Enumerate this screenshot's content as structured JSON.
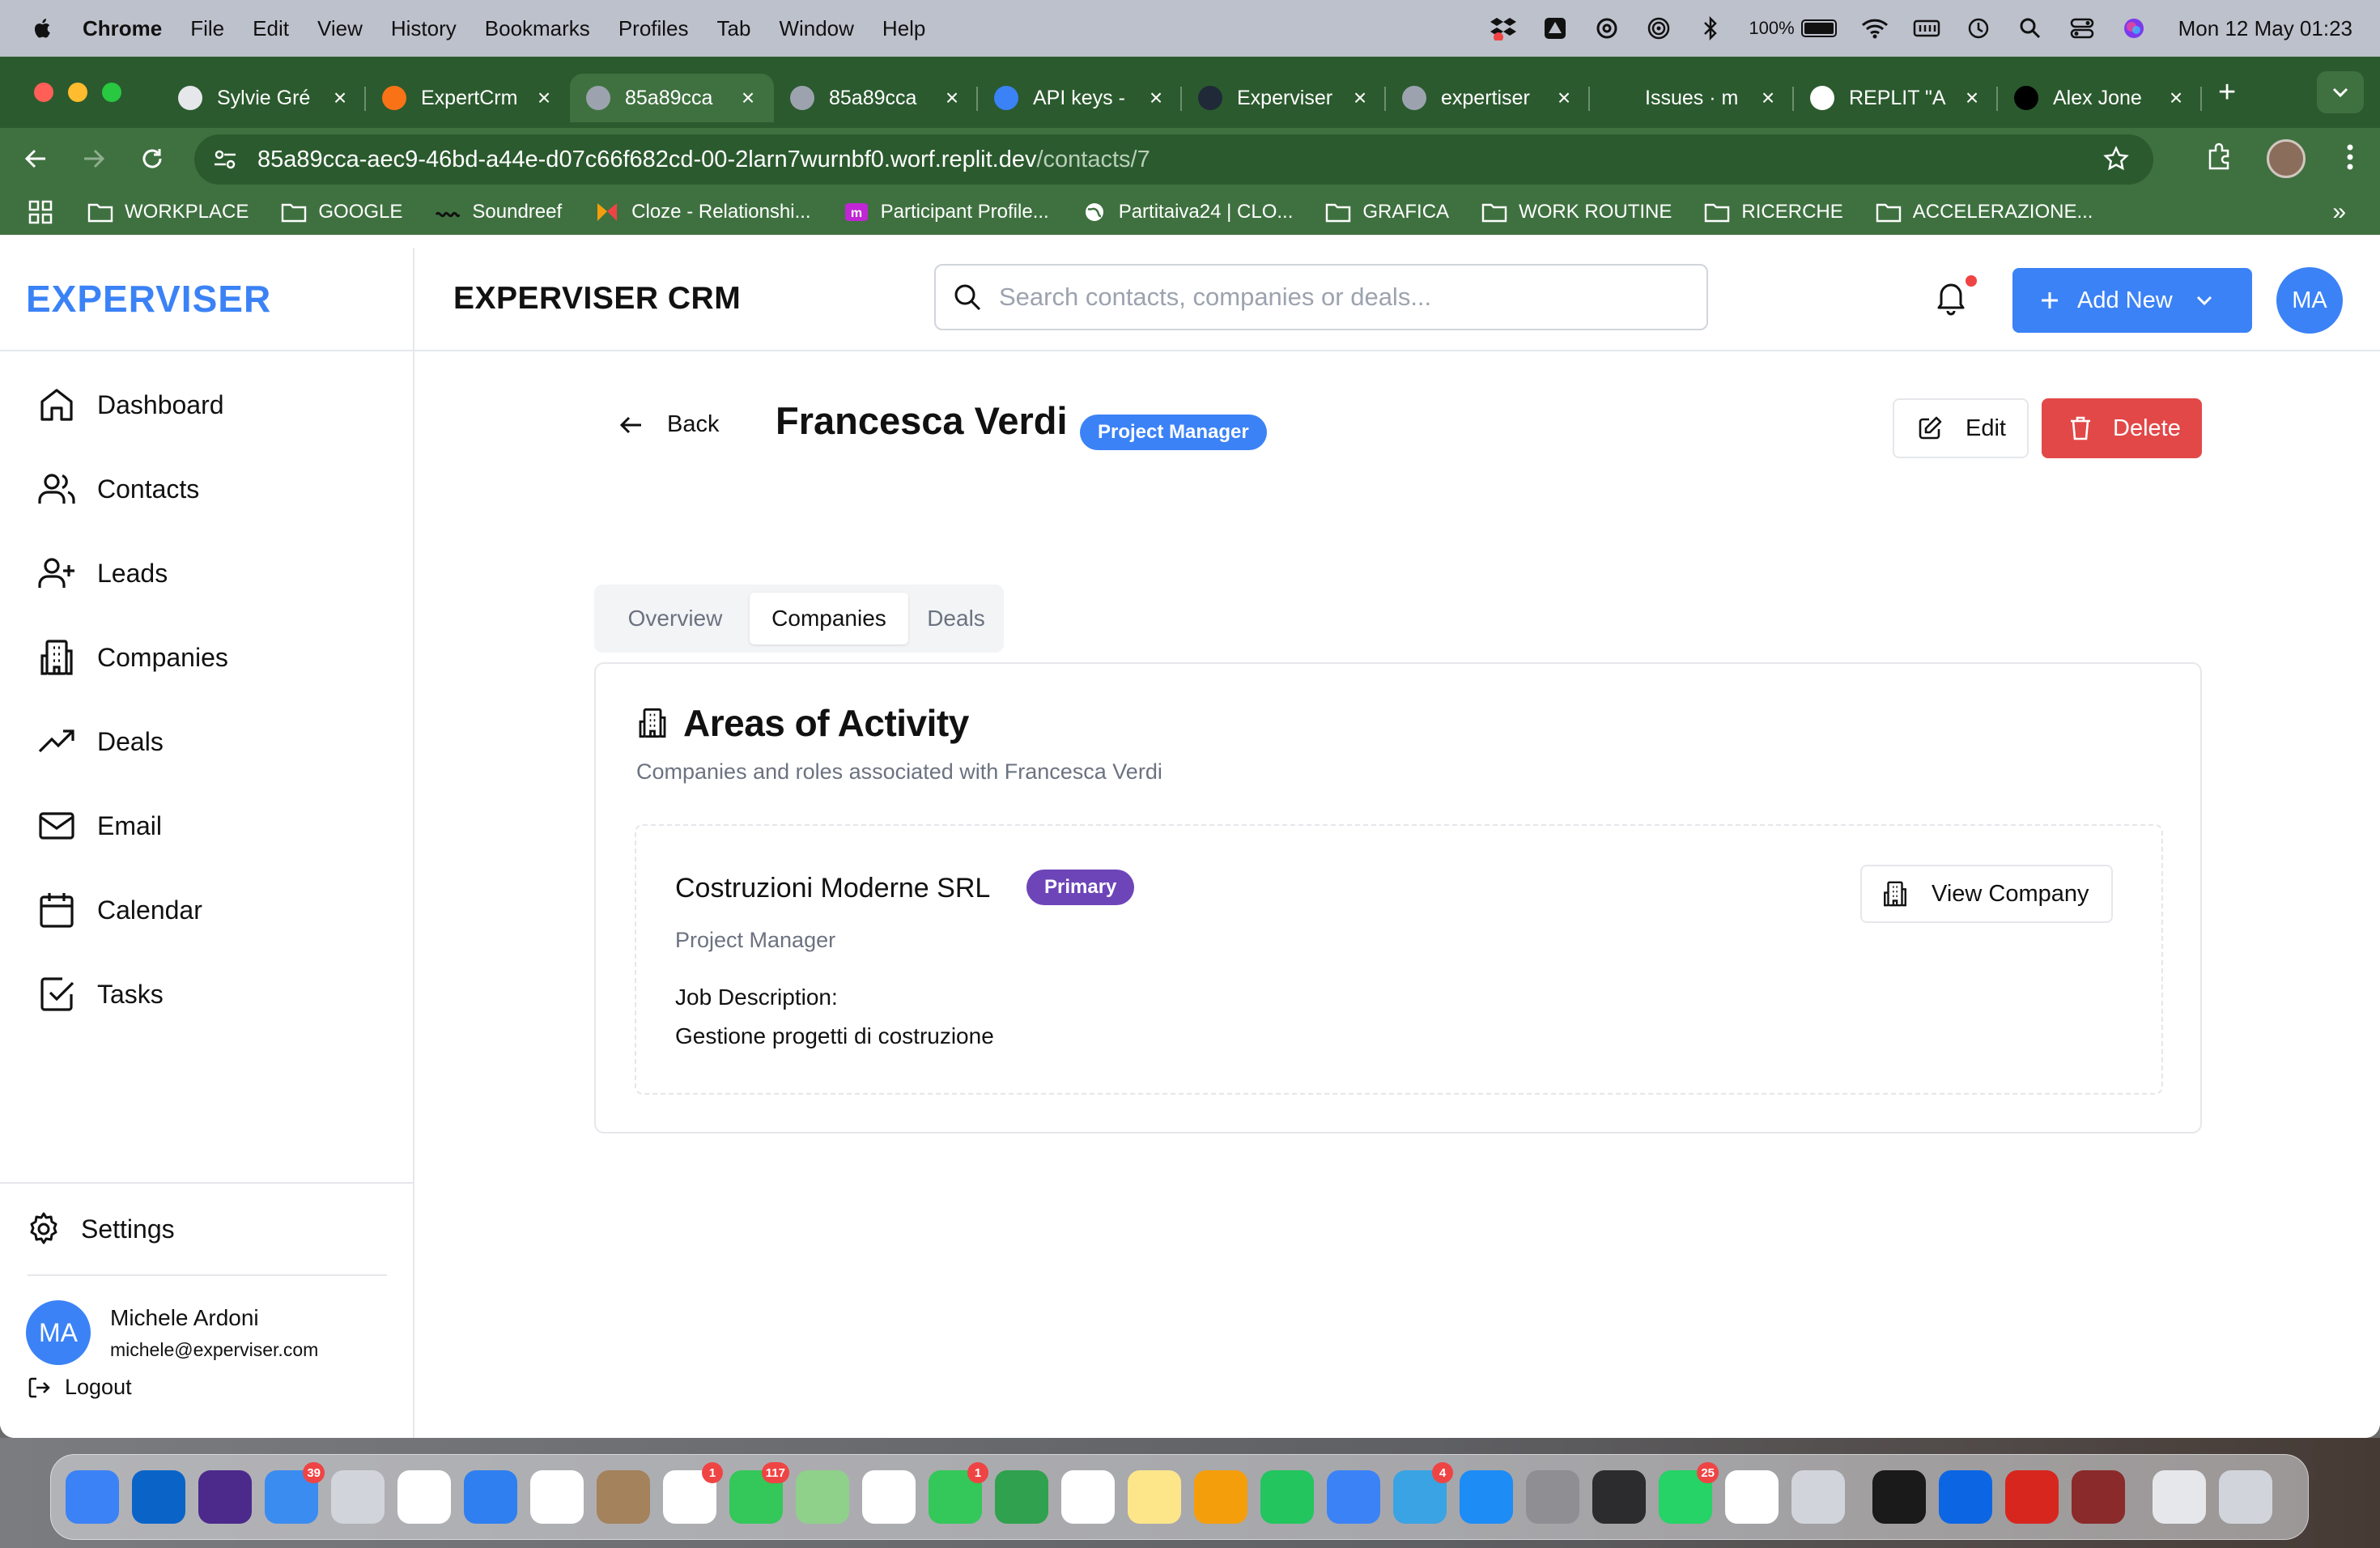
{
  "menubar": {
    "app": "Chrome",
    "menus": [
      "File",
      "Edit",
      "View",
      "History",
      "Bookmarks",
      "Profiles",
      "Tab",
      "Window",
      "Help"
    ],
    "battery": "100%",
    "clock": "Mon 12 May  01:23"
  },
  "browser": {
    "tabs": [
      {
        "title": "Sylvie Gré",
        "favicon_color": "#e5e7eb"
      },
      {
        "title": "ExpertCrm",
        "favicon_color": "#f97316"
      },
      {
        "title": "85a89cca",
        "favicon_color": "#9ca3af"
      },
      {
        "title": "85a89cca",
        "favicon_color": "#9ca3af"
      },
      {
        "title": "API keys -",
        "favicon_color": "#3b82f6"
      },
      {
        "title": "Experviser",
        "favicon_color": "#1f2937"
      },
      {
        "title": "expertiser",
        "favicon_color": "#9ca3af"
      },
      {
        "title": "Issues · m",
        "favicon_color": "#2b5a2e"
      },
      {
        "title": "REPLIT \"A",
        "favicon_color": "#ffffff"
      },
      {
        "title": "Alex Jone",
        "favicon_color": "#000000"
      }
    ],
    "active_tab": 2,
    "url_host": "85a89cca-aec9-46bd-a44e-d07c66f682cd-00-2larn7wurnbf0.worf.replit.dev",
    "url_path": "/contacts/7",
    "bookmarks": [
      {
        "label": "WORKPLACE",
        "icon": "folder-icon"
      },
      {
        "label": "GOOGLE",
        "icon": "folder-icon"
      },
      {
        "label": "Soundreef",
        "icon": "soundreef-icon"
      },
      {
        "label": "Cloze - Relationshi...",
        "icon": "cloze-icon"
      },
      {
        "label": "Participant Profile...",
        "icon": "m-icon"
      },
      {
        "label": "Partitaiva24 | CLO...",
        "icon": "globe-icon"
      },
      {
        "label": "GRAFICA",
        "icon": "folder-icon"
      },
      {
        "label": "WORK ROUTINE",
        "icon": "folder-icon"
      },
      {
        "label": "RICERCHE",
        "icon": "folder-icon"
      },
      {
        "label": "ACCELERAZIONE...",
        "icon": "folder-icon"
      }
    ],
    "more": "»"
  },
  "app": {
    "brand": "EXPERVISER",
    "title": "EXPERVISER CRM",
    "search_placeholder": "Search contacts, companies or deals...",
    "add_new": "Add New",
    "avatar_initials": "MA",
    "accent": "#3b82f6",
    "nav": [
      {
        "label": "Dashboard",
        "icon": "home-icon"
      },
      {
        "label": "Contacts",
        "icon": "users-icon"
      },
      {
        "label": "Leads",
        "icon": "user-plus-icon"
      },
      {
        "label": "Companies",
        "icon": "building-icon"
      },
      {
        "label": "Deals",
        "icon": "trending-up-icon"
      },
      {
        "label": "Email",
        "icon": "mail-icon"
      },
      {
        "label": "Calendar",
        "icon": "calendar-icon"
      },
      {
        "label": "Tasks",
        "icon": "checkbox-icon"
      }
    ],
    "settings": "Settings",
    "user": {
      "initials": "MA",
      "name": "Michele Ardoni",
      "email": "michele@experviser.com"
    },
    "logout": "Logout"
  },
  "contact": {
    "back": "Back",
    "name": "Francesca Verdi",
    "role_badge": "Project Manager",
    "edit": "Edit",
    "delete": "Delete",
    "delete_color": "#e24848",
    "tabs": [
      "Overview",
      "Companies",
      "Deals"
    ],
    "active_tab": "Companies",
    "areas": {
      "title": "Areas of Activity",
      "subtitle": "Companies and roles associated with Francesca Verdi",
      "company": {
        "name": "Costruzioni Moderne SRL",
        "badge": "Primary",
        "badge_color": "#6d45b8",
        "role": "Project Manager",
        "job_label": "Job Description:",
        "job_text": "Gestione progetti di costruzione",
        "view_button": "View Company"
      }
    }
  },
  "dock": {
    "apps": [
      {
        "name": "finder",
        "color": "#3b82f6",
        "badge": ""
      },
      {
        "name": "outlook",
        "color": "#0a64c8",
        "badge": ""
      },
      {
        "name": "siri",
        "color": "#4b2a8c",
        "badge": ""
      },
      {
        "name": "mail",
        "color": "#3b8cf0",
        "badge": "39"
      },
      {
        "name": "launchpad",
        "color": "#d1d5db",
        "badge": ""
      },
      {
        "name": "chrome",
        "color": "#ffffff",
        "badge": ""
      },
      {
        "name": "safari",
        "color": "#2f7ff0",
        "badge": ""
      },
      {
        "name": "opera",
        "color": "#ffffff",
        "badge": ""
      },
      {
        "name": "contacts",
        "color": "#a4825c",
        "badge": ""
      },
      {
        "name": "calendar",
        "color": "#ffffff",
        "badge": "1"
      },
      {
        "name": "messages",
        "color": "#34c759",
        "badge": "117"
      },
      {
        "name": "maps",
        "color": "#8fd18a",
        "badge": ""
      },
      {
        "name": "photos",
        "color": "#ffffff",
        "badge": ""
      },
      {
        "name": "facetime",
        "color": "#34c759",
        "badge": "1"
      },
      {
        "name": "messages-2",
        "color": "#30a14e",
        "badge": ""
      },
      {
        "name": "evernote",
        "color": "#ffffff",
        "badge": ""
      },
      {
        "name": "notes",
        "color": "#fde68a",
        "badge": ""
      },
      {
        "name": "pages",
        "color": "#f59e0b",
        "badge": ""
      },
      {
        "name": "numbers",
        "color": "#22c55e",
        "badge": ""
      },
      {
        "name": "keynote",
        "color": "#3b82f6",
        "badge": ""
      },
      {
        "name": "telegram",
        "color": "#3aa3e3",
        "badge": "4"
      },
      {
        "name": "app-store",
        "color": "#1d8cf5",
        "badge": ""
      },
      {
        "name": "settings",
        "color": "#8e8e93",
        "badge": ""
      },
      {
        "name": "phone",
        "color": "#2c2c2e",
        "badge": ""
      },
      {
        "name": "whatsapp",
        "color": "#25d366",
        "badge": "25"
      },
      {
        "name": "chatgpt",
        "color": "#ffffff",
        "badge": ""
      },
      {
        "name": "iphone-mirroring",
        "color": "#d1d5db",
        "badge": ""
      },
      {
        "name": "spotify",
        "color": "#1a1a1a",
        "badge": ""
      },
      {
        "name": "trello",
        "color": "#0c66e4",
        "badge": ""
      },
      {
        "name": "acrobat",
        "color": "#d7261e",
        "badge": ""
      },
      {
        "name": "dictionary",
        "color": "#8b2a2a",
        "badge": ""
      },
      {
        "name": "downloads",
        "color": "#e5e7eb",
        "badge": ""
      },
      {
        "name": "trash",
        "color": "#d1d5db",
        "badge": ""
      }
    ]
  }
}
